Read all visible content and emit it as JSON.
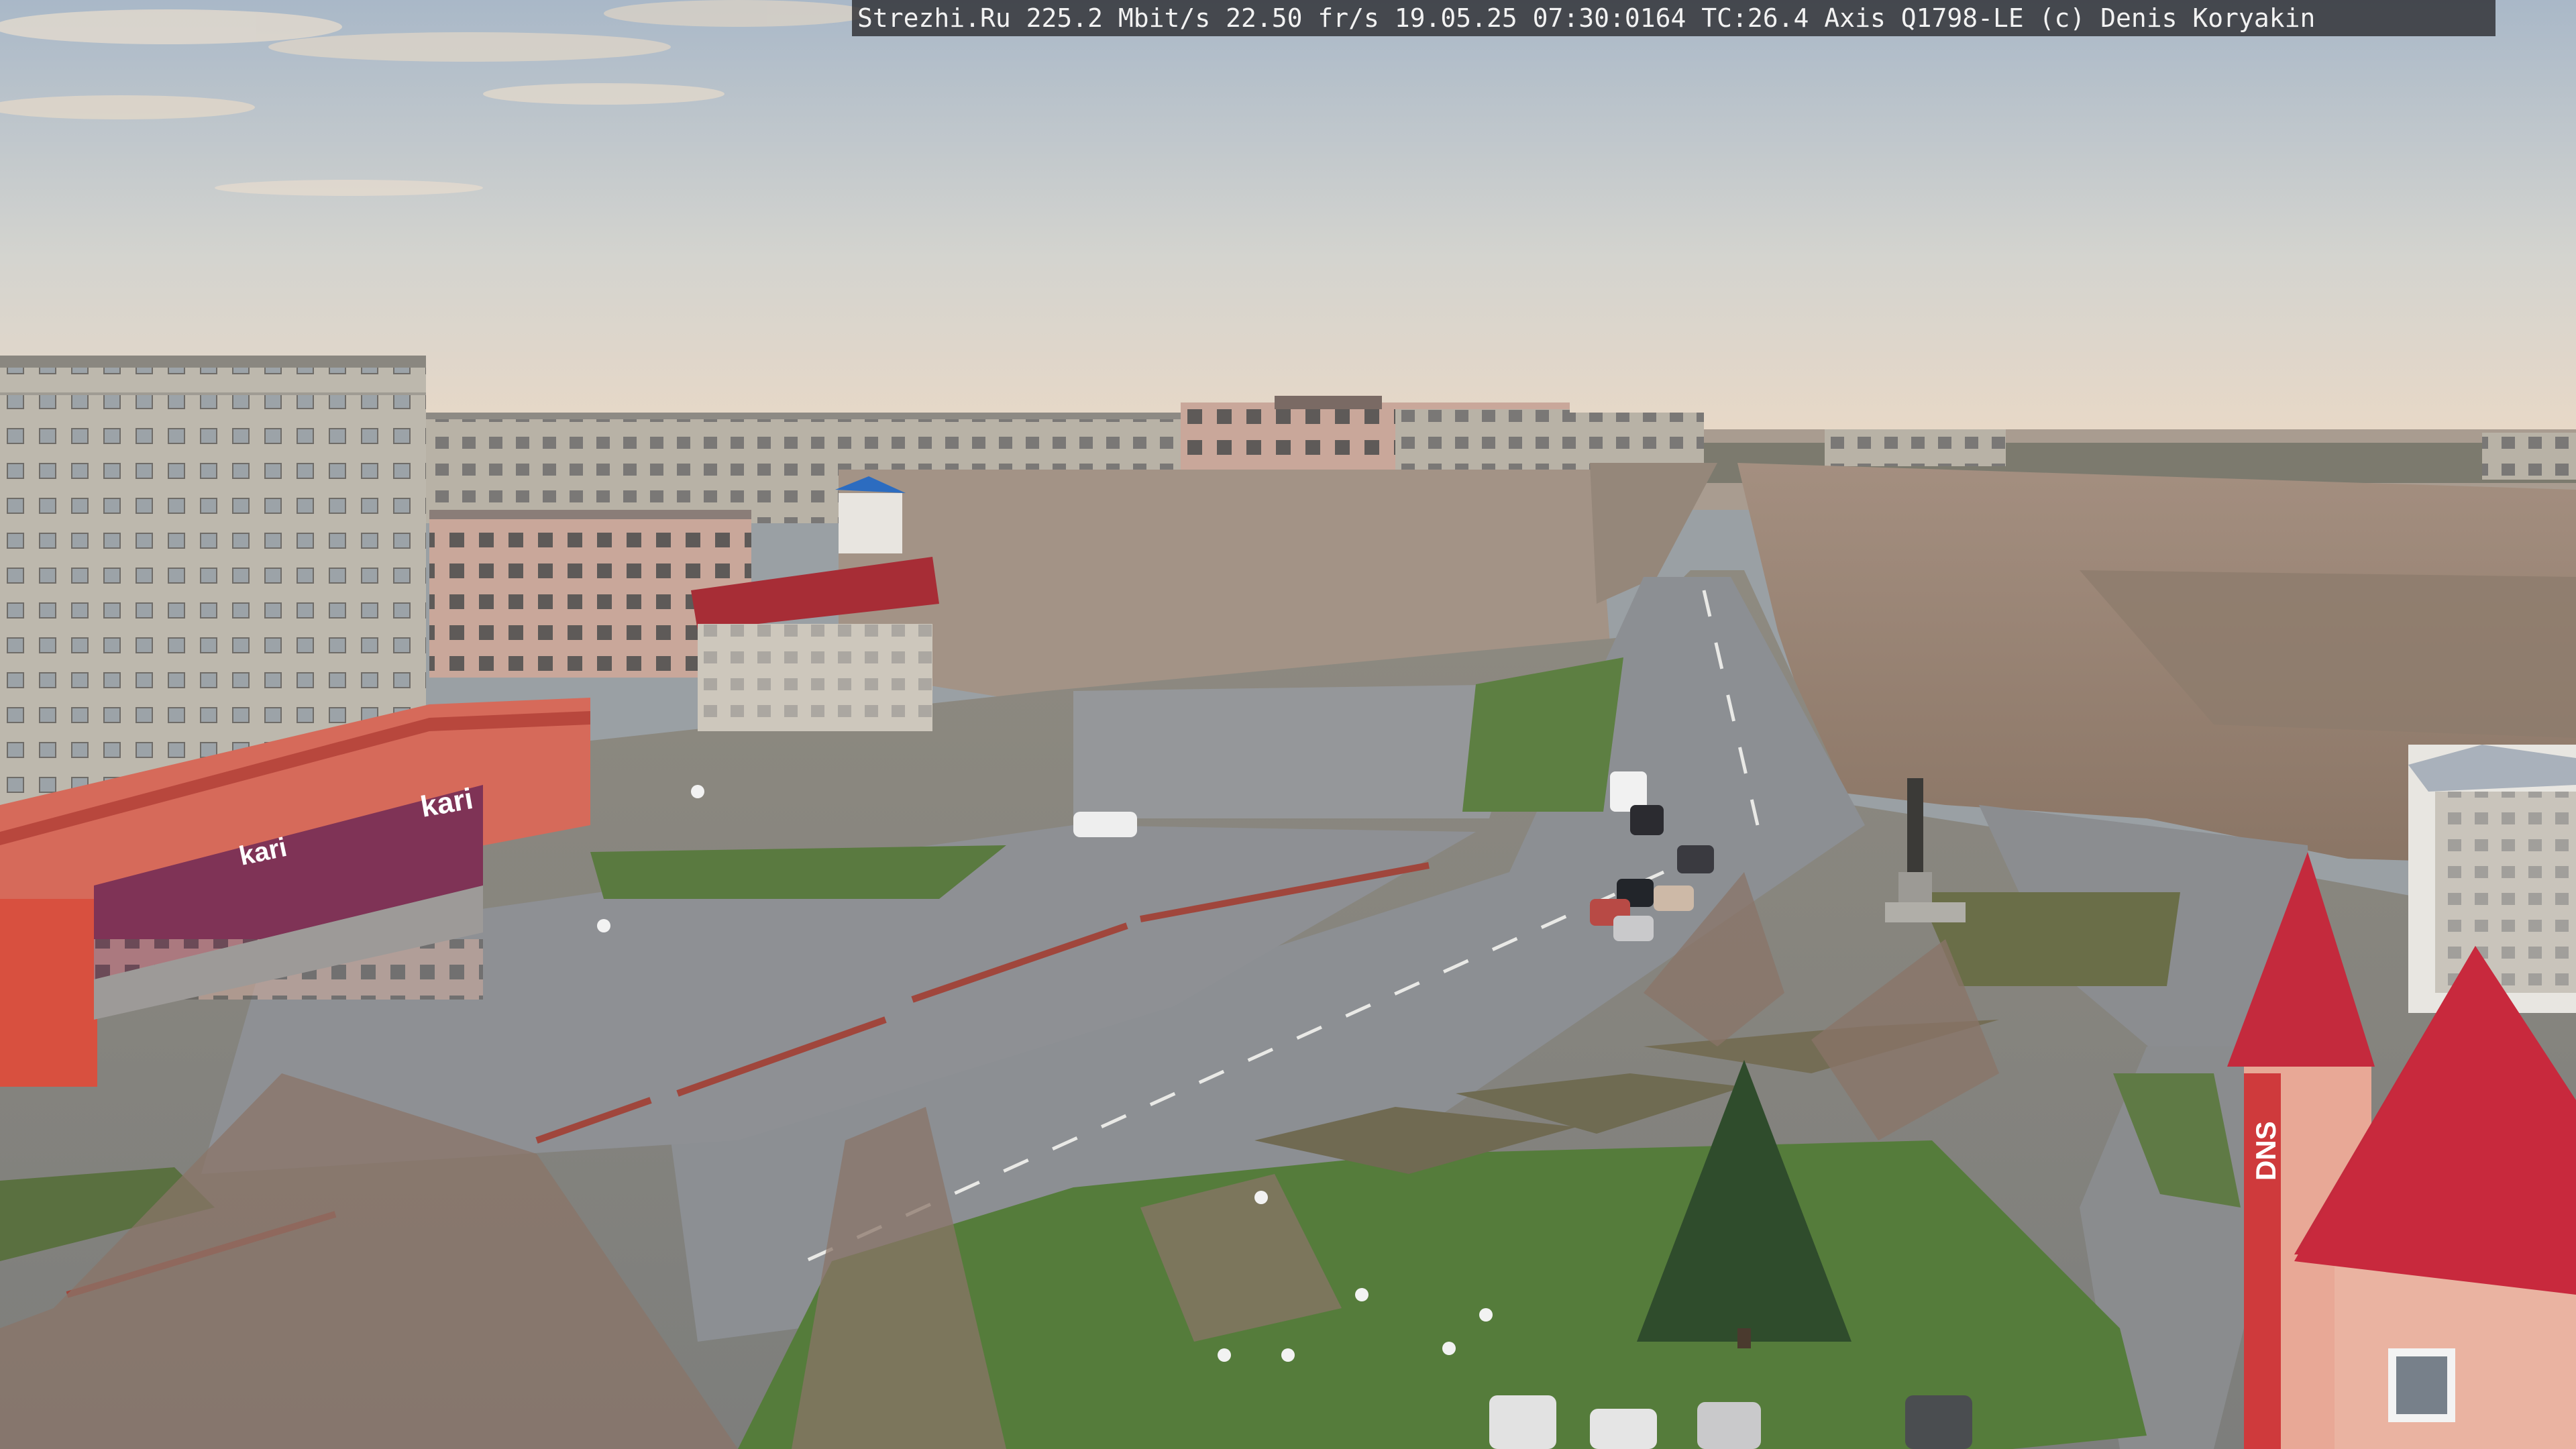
{
  "overlay": {
    "text": "Strezhi.Ru 225.2 Mbit/s 22.50 fr/s 19.05.25 07:30:0164 TC:26.4  Axis Q1798-LE  (c) Denis Koryakin"
  },
  "storefront": {
    "sign_main": "kari",
    "sign_secondary": "kari"
  },
  "store_right": {
    "sign": "DNS"
  },
  "colors": {
    "sky_top": "#aebccb",
    "sky_horizon": "#ead9c6",
    "asphalt": "#8f9296",
    "grass": "#4f7a3a",
    "roof_red": "#c0283a",
    "panel_building": "#b9b4aa"
  }
}
